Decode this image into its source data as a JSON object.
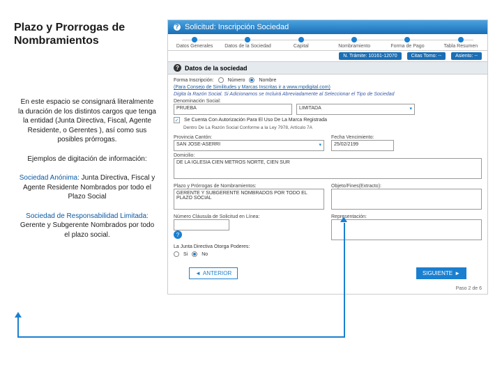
{
  "left": {
    "title": "Plazo y Prorrogas de Nombramientos",
    "p1": "En este espacio se consignará literalmente la duración de los distintos cargos que tenga la entidad (Junta Directiva, Fiscal, Agente Residente, o Gerentes ), así como sus posibles prórrogas.",
    "p2": "Ejemplos de digitación de información:",
    "p3_label": "Sociedad Anónima:",
    "p3_text": " Junta Directiva, Fiscal y Agente Residente Nombrados por todo el Plazo Social",
    "p4_label": "Sociedad de Responsabilidad Limitada:",
    "p4_text": " Gerente y Subgerente Nombrados por todo el plazo social."
  },
  "wizard": {
    "title": "Solicitud: Inscripción Sociedad",
    "steps": [
      "Datos Generales",
      "Datos de la Sociedad",
      "Capital",
      "Nombramiento",
      "Forma de Pago",
      "Tabla Resumen"
    ],
    "meta": {
      "tramite": "N. Trámite: 10161-12070",
      "citas": "Citas Tomo: --",
      "asiento": "Asiento: --"
    },
    "section": "Datos de la sociedad",
    "forma_label": "Forma Inscripción:",
    "radio1": "Número",
    "radio2": "Nombre",
    "tip": "(Para Consejo de Similitudes y Marcas Inscritas ir a www.rnpdigital.com)",
    "italic_note": "Digita la Razón Social. Si Adicionamos se Incluirá Abreviadamente al Seleccionar el Tipo de Sociedad",
    "denom_label": "Denominación Social:",
    "denom_value": "PRUEBA",
    "tipo_value": "LIMITADA",
    "marca_check": "Se Cuenta Con Autorización Para El Uso De La Marca Registrada",
    "marca_sub": "Dentro De La Razón Social Conforme a la Ley 7978, Artículo 7A",
    "provincia_label": "Provincia Cantón:",
    "provincia_value": "SAN JOSE-ASERRI",
    "fecha_label": "Fecha Vencimiento:",
    "fecha_value": "25/02/2199",
    "domicilio_label": "Domicilio:",
    "domicilio_value": "DE LA IGLESIA CIEN METROS NORTE, CIEN SUR",
    "plazo_label": "Plazo y Prórrogas de Nombramientos:",
    "plazo_value": "GERENTE Y SUBGERENTE NOMBRADOS POR TODO EL PLAZO SOCIAL",
    "objeto_label": "Objeto/Fines(Extracto):",
    "clausula_label": "Número Cláusula de Solicitud en Línea:",
    "representacion_label": "Representación:",
    "junta_line": "La Junta Directiva Otorga Poderes:",
    "si": "Si",
    "no": "No",
    "btn_prev": "ANTERIOR",
    "btn_next": "SIGUIENTE",
    "paso": "Paso 2 de 6"
  }
}
